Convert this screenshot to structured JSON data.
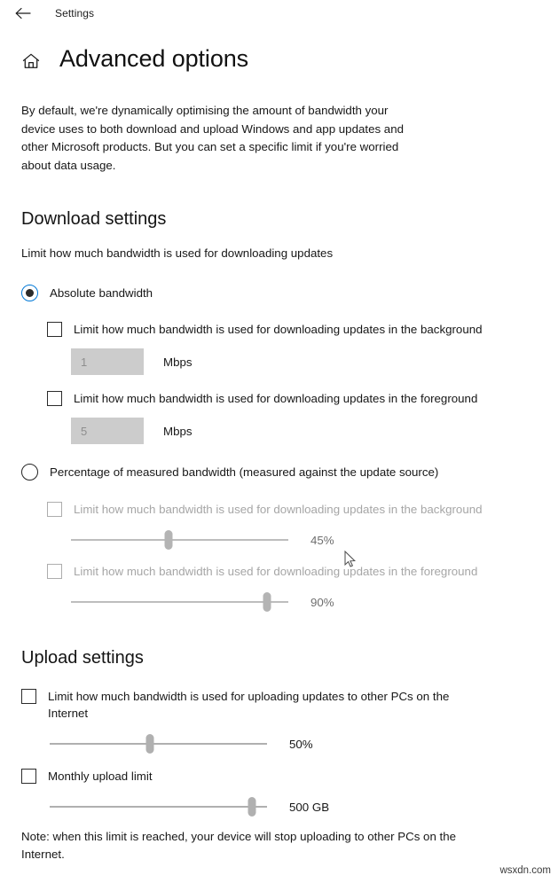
{
  "titlebar": {
    "back_icon": "back-arrow-icon",
    "title": "Settings"
  },
  "header": {
    "home_icon": "home-icon",
    "title": "Advanced options"
  },
  "intro": "By default, we're dynamically optimising the amount of bandwidth your device uses to both download and upload Windows and app updates and other Microsoft products. But you can set a specific limit if you're worried about data usage.",
  "download": {
    "section_title": "Download settings",
    "subtitle": "Limit how much bandwidth is used for downloading updates",
    "absolute": {
      "radio_label": "Absolute bandwidth",
      "selected": true,
      "background": {
        "checkbox_label": "Limit how much bandwidth is used for downloading updates in the background",
        "checked": false,
        "value": "1",
        "unit": "Mbps"
      },
      "foreground": {
        "checkbox_label": "Limit how much bandwidth is used for downloading updates in the foreground",
        "checked": false,
        "value": "5",
        "unit": "Mbps"
      }
    },
    "percentage": {
      "radio_label": "Percentage of measured bandwidth (measured against the update source)",
      "selected": false,
      "background": {
        "checkbox_label": "Limit how much bandwidth is used for downloading updates in the background",
        "checked": false,
        "slider_value": "45%",
        "slider_percent": 45
      },
      "foreground": {
        "checkbox_label": "Limit how much bandwidth is used for downloading updates in the foreground",
        "checked": false,
        "slider_value": "90%",
        "slider_percent": 90
      }
    }
  },
  "upload": {
    "section_title": "Upload settings",
    "bandwidth": {
      "checkbox_label": "Limit how much bandwidth is used for uploading updates to other PCs on the Internet",
      "checked": false,
      "slider_value": "50%",
      "slider_percent": 46
    },
    "monthly": {
      "checkbox_label": "Monthly upload limit",
      "checked": false,
      "slider_value": "500 GB",
      "slider_percent": 93
    },
    "note": "Note: when this limit is reached, your device will stop uploading to other PCs on the Internet."
  },
  "accent_color": "#0078d7",
  "watermark": "wsxdn.com"
}
